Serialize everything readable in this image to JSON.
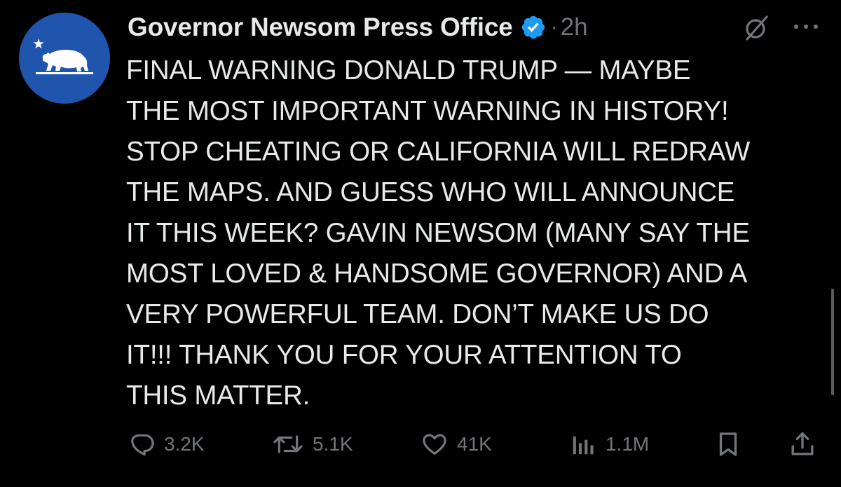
{
  "author": {
    "display_name": "Governor Newsom Press Office",
    "separator": "·",
    "time_ago": "2h"
  },
  "tweet": {
    "lines": [
      "FINAL WARNING DONALD TRUMP — MAYBE",
      "THE MOST IMPORTANT WARNING IN HISTORY!",
      "STOP CHEATING OR CALIFORNIA WILL REDRAW",
      "THE MAPS. AND GUESS WHO WILL ANNOUNCE",
      "IT THIS WEEK? GAVIN NEWSOM (MANY SAY THE",
      "MOST LOVED & HANDSOME GOVERNOR) AND A",
      "VERY POWERFUL TEAM. DON’T MAKE US DO",
      "IT!!! THANK YOU FOR YOUR ATTENTION TO",
      "THIS MATTER."
    ]
  },
  "actions": {
    "replies": "3.2K",
    "reposts": "5.1K",
    "likes": "41K",
    "views": "1.1M"
  },
  "icons": {
    "avatar": "california-bear-star-icon",
    "verified": "verified-badge-icon",
    "grok": "grok-icon",
    "more": "more-options-icon",
    "reply": "reply-icon",
    "repost": "repost-icon",
    "like": "like-icon",
    "views": "views-icon",
    "bookmark": "bookmark-icon",
    "share": "share-icon"
  },
  "colors": {
    "background": "#000000",
    "text": "#e7e9ea",
    "muted": "#71767b",
    "verified": "#1d9bf0",
    "avatar": "#1f55ad"
  }
}
